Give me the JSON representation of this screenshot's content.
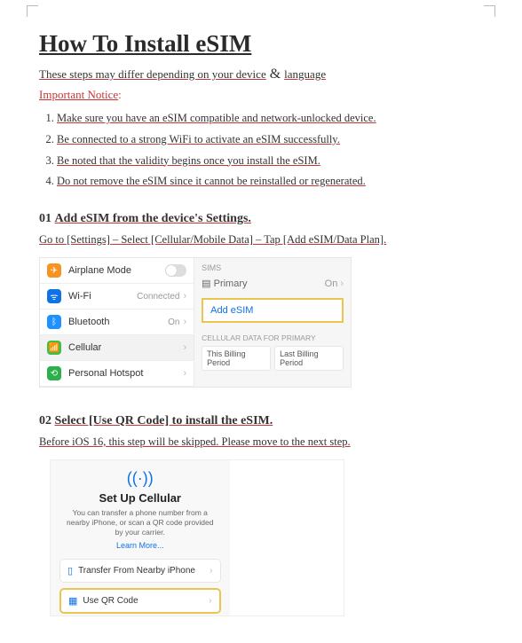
{
  "title": "How To Install eSIM",
  "intro_a": "These steps may differ depending on your device",
  "intro_amp": " & ",
  "intro_b": "language",
  "notice_label": "Important Notice",
  "notice_colon": ":",
  "important": [
    "Make sure you have an eSIM compatible and network-unlocked device.",
    "Be connected to a strong WiFi to activate an eSIM successfully.",
    "Be noted that the validity begins once you install the eSIM.",
    "Do not remove the eSIM since it cannot be reinstalled or regenerated."
  ],
  "step1": {
    "num": "01",
    "title": "Add eSIM from the device's Settings.",
    "sub": "Go to [Settings] – Select [Cellular/Mobile Data] – Tap [Add eSIM/Data Plan]."
  },
  "shot1": {
    "rows": {
      "airplane": "Airplane Mode",
      "wifi": "Wi-Fi",
      "wifi_val": "Connected",
      "bt": "Bluetooth",
      "bt_val": "On",
      "cell": "Cellular",
      "hotspot": "Personal Hotspot"
    },
    "right": {
      "sims": "SIMs",
      "primary": "Primary",
      "on": "On",
      "add": "Add eSIM",
      "celldata": "CELLULAR DATA FOR PRIMARY",
      "pill1": "This Billing Period",
      "pill2": "Last Billing Period"
    },
    "chev": "›"
  },
  "step2": {
    "num": "02",
    "title": "Select [Use QR Code] to install the eSIM.",
    "sub": "Before iOS 16, this step will be skipped. Please move to the next step."
  },
  "shot2": {
    "icon": "((·))",
    "title": "Set Up Cellular",
    "desc": "You can transfer a phone number from a nearby iPhone, or scan a QR code provided by your carrier.",
    "learn": "Learn More...",
    "opt1": "Transfer From Nearby iPhone",
    "opt2": "Use QR Code",
    "chev": "›"
  }
}
